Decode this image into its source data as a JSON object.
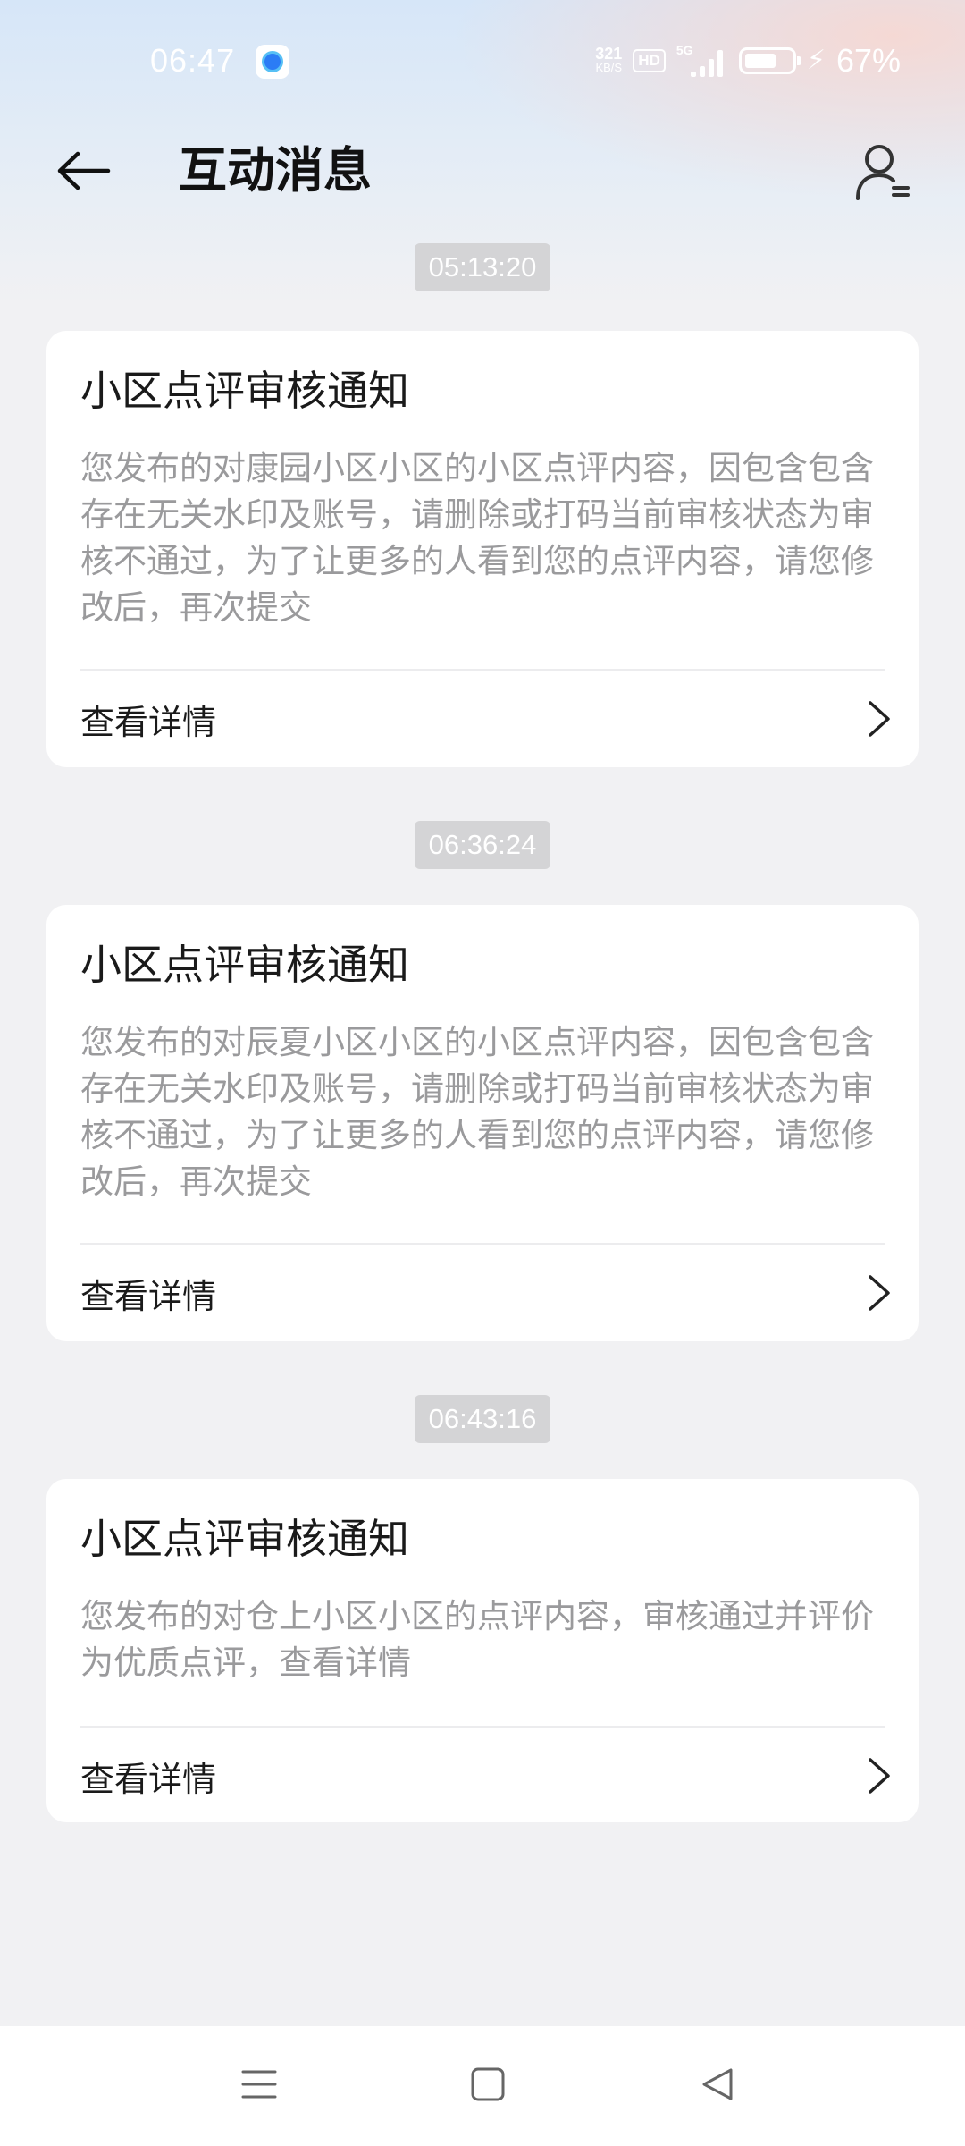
{
  "status_bar": {
    "time": "06:47",
    "net_speed_value": "321",
    "net_speed_unit": "KB/S",
    "hd_label": "HD",
    "network_type": "5G",
    "battery_percent": "67%",
    "battery_level": 0.67
  },
  "header": {
    "title": "互动消息"
  },
  "messages": [
    {
      "timestamp": "05:13:20",
      "title": "小区点评审核通知",
      "body": "您发布的对康园小区小区的小区点评内容，因包含包含存在无关水印及账号，请删除或打码当前审核状态为审核不通过，为了让更多的人看到您的点评内容，请您修改后，再次提交",
      "action_label": "查看详情"
    },
    {
      "timestamp": "06:36:24",
      "title": "小区点评审核通知",
      "body": "您发布的对辰夏小区小区的小区点评内容，因包含包含存在无关水印及账号，请删除或打码当前审核状态为审核不通过，为了让更多的人看到您的点评内容，请您修改后，再次提交",
      "action_label": "查看详情"
    },
    {
      "timestamp": "06:43:16",
      "title": "小区点评审核通知",
      "body": "您发布的对仓上小区小区的点评内容，审核通过并评价为优质点评，查看详情",
      "action_label": "查看详情"
    }
  ],
  "icons": {
    "back": "arrow-left-icon",
    "profile": "user-settings-icon",
    "chevron": "chevron-right-icon",
    "nav_menu": "menu-icon",
    "nav_home": "square-icon",
    "nav_back": "triangle-back-icon"
  },
  "colors": {
    "page_bg": "#f1f1f3",
    "card_bg": "#ffffff",
    "timestamp_badge": "#d4d4d6",
    "body_text": "#9a9a9c"
  }
}
